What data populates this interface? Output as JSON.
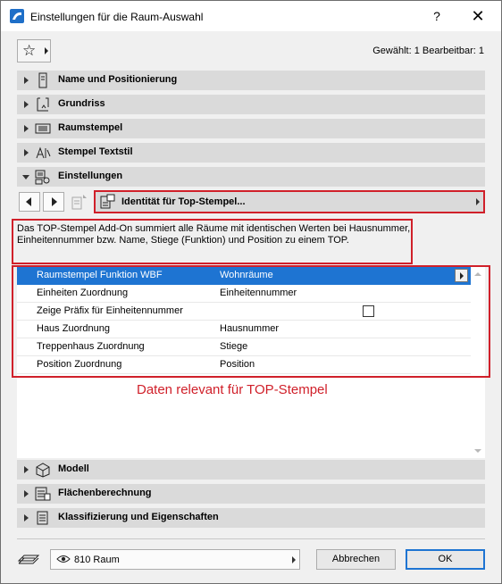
{
  "window": {
    "title": "Einstellungen für die Raum-Auswahl",
    "help": "?",
    "close": "✕"
  },
  "toolbar": {
    "selection_info": "Gewählt: 1 Bearbeitbar: 1"
  },
  "sections_top": [
    {
      "label": "Name und Positionierung",
      "icon": "name-position-icon",
      "expanded": false
    },
    {
      "label": "Grundriss",
      "icon": "floorplan-icon",
      "expanded": false
    },
    {
      "label": "Raumstempel",
      "icon": "zone-stamp-icon",
      "expanded": false
    },
    {
      "label": "Stempel Textstil",
      "icon": "text-style-icon",
      "expanded": false
    },
    {
      "label": "Einstellungen",
      "icon": "settings-icon",
      "expanded": true
    }
  ],
  "panel": {
    "selected": "Identität für Top-Stempel..."
  },
  "description": "Das TOP-Stempel Add-On summiert alle Räume mit identischen Werten bei Hausnummer, Einheitennummer bzw. Name, Stiege (Funktion) und Position zu einem TOP.",
  "table": {
    "rows": [
      {
        "name": "Raumstempel Funktion WBF",
        "value": "Wohnräume",
        "selected": true
      },
      {
        "name": "Einheiten Zuordnung",
        "value": "Einheitennummer"
      },
      {
        "name": "Zeige Präfix für Einheitennummer",
        "value": "",
        "checkbox": false
      },
      {
        "name": "Haus Zuordnung",
        "value": "Hausnummer"
      },
      {
        "name": "Treppenhaus Zuordnung",
        "value": "Stiege"
      },
      {
        "name": "Position Zuordnung",
        "value": "Position"
      }
    ]
  },
  "annotation": "Daten relevant für TOP-Stempel",
  "sections_bottom": [
    {
      "label": "Modell",
      "icon": "model-icon",
      "expanded": false
    },
    {
      "label": "Flächenberechnung",
      "icon": "area-calc-icon",
      "expanded": false
    },
    {
      "label": "Klassifizierung und Eigenschaften",
      "icon": "classification-icon",
      "expanded": false
    }
  ],
  "footer": {
    "layer": "810 Raum",
    "cancel": "Abbrechen",
    "ok": "OK"
  },
  "colors": {
    "accent": "#1e74d2",
    "highlight": "#d0202a",
    "section_bg": "#dadada"
  }
}
